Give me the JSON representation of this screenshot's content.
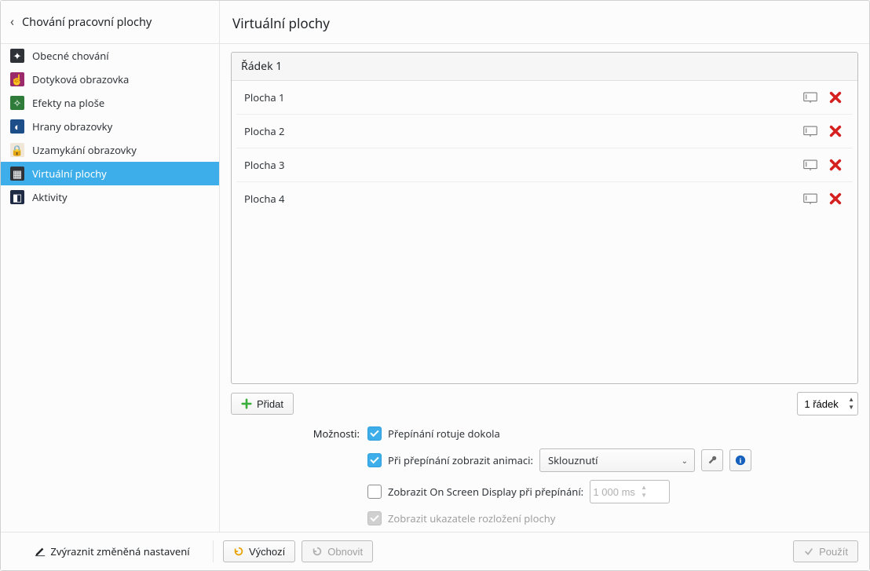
{
  "sidebar": {
    "back_label": "Chování pracovní plochy",
    "items": [
      {
        "label": "Obecné chování"
      },
      {
        "label": "Dotyková obrazovka"
      },
      {
        "label": "Efekty na ploše"
      },
      {
        "label": "Hrany obrazovky"
      },
      {
        "label": "Uzamykání obrazovky"
      },
      {
        "label": "Virtuální plochy"
      },
      {
        "label": "Aktivity"
      }
    ]
  },
  "page": {
    "title": "Virtuální plochy"
  },
  "desktops": {
    "section_title": "Řádek 1",
    "rows": [
      {
        "name": "Plocha 1"
      },
      {
        "name": "Plocha 2"
      },
      {
        "name": "Plocha 3"
      },
      {
        "name": "Plocha 4"
      }
    ]
  },
  "add_button": "Přidat",
  "row_spinner_label": "1 řádek",
  "options": {
    "heading": "Možnosti:",
    "wraparound": "Přepínání rotuje dokola",
    "show_animation": "Při přepínání zobrazit animaci:",
    "animation_value": "Sklouznutí",
    "show_osd": "Zobrazit On Screen Display při přepínání:",
    "osd_duration": "1 000 ms",
    "show_layout_indicator": "Zobrazit ukazatele rozložení plochy"
  },
  "footer": {
    "highlight_changed": "Zvýraznit změněná nastavení",
    "defaults": "Výchozí",
    "reset": "Obnovit",
    "apply": "Použít"
  }
}
